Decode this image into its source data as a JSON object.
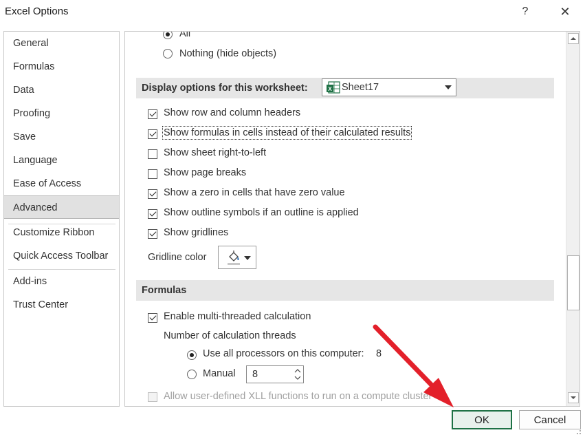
{
  "window": {
    "title": "Excel Options",
    "help_glyph": "?",
    "close_glyph": "✕"
  },
  "nav": {
    "items": [
      {
        "id": "general",
        "label": "General"
      },
      {
        "id": "formulas",
        "label": "Formulas"
      },
      {
        "id": "data",
        "label": "Data"
      },
      {
        "id": "proofing",
        "label": "Proofing"
      },
      {
        "id": "save",
        "label": "Save"
      },
      {
        "id": "language",
        "label": "Language"
      },
      {
        "id": "ease",
        "label": "Ease of Access"
      },
      {
        "id": "advanced",
        "label": "Advanced",
        "selected": true
      },
      {
        "id": "ribbon",
        "label": "Customize Ribbon"
      },
      {
        "id": "qat",
        "label": "Quick Access Toolbar"
      },
      {
        "id": "addins",
        "label": "Add-ins"
      },
      {
        "id": "trust",
        "label": "Trust Center"
      }
    ]
  },
  "objects": {
    "all_label": "All",
    "nothing_label": "Nothing (hide objects)"
  },
  "display_sheet": {
    "header": "Display options for this worksheet:",
    "sheet_selected": "Sheet17",
    "options": [
      {
        "label": "Show row and column headers",
        "checked": true
      },
      {
        "label": "Show formulas in cells instead of their calculated results",
        "checked": true
      },
      {
        "label": "Show sheet right-to-left",
        "checked": false
      },
      {
        "label": "Show page breaks",
        "checked": false
      },
      {
        "label": "Show a zero in cells that have zero value",
        "checked": true
      },
      {
        "label": "Show outline symbols if an outline is applied",
        "checked": true
      },
      {
        "label": "Show gridlines",
        "checked": true
      }
    ],
    "gridline_color_label": "Gridline color"
  },
  "formulas": {
    "header": "Formulas",
    "multithread_label": "Enable multi-threaded calculation",
    "threads_label": "Number of calculation threads",
    "use_all_label": "Use all processors on this computer:",
    "processor_count": "8",
    "manual_label": "Manual",
    "manual_value": "8",
    "xll_label": "Allow user-defined XLL functions to run on a compute cluster"
  },
  "buttons": {
    "ok": "OK",
    "cancel": "Cancel"
  },
  "colors": {
    "ok_border": "#1e7145",
    "arrow": "#e3202a",
    "excel_green": "#1e7145"
  }
}
